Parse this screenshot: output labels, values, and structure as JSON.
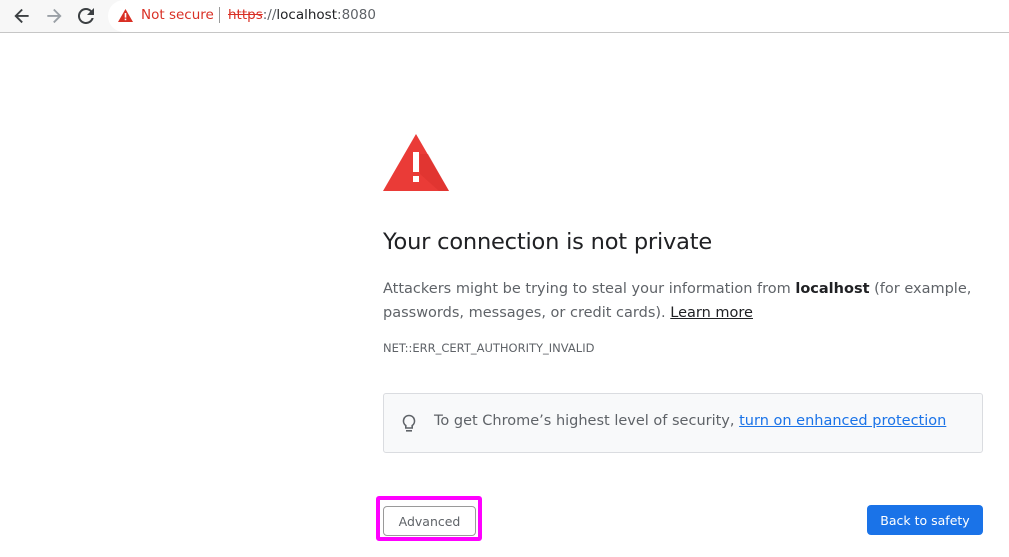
{
  "browser": {
    "nav": {
      "back_icon": "arrow-left-icon",
      "forward_icon": "arrow-right-icon",
      "reload_icon": "reload-icon"
    },
    "omnibox": {
      "security_icon": "warning-triangle-icon",
      "security_label": "Not secure",
      "url_scheme": "https",
      "url_separator": "://",
      "url_host": "localhost",
      "url_port": ":8080"
    }
  },
  "interstitial": {
    "icon": "warning-triangle-icon",
    "heading": "Your connection is not private",
    "description_prefix": "Attackers might be trying to steal your information from ",
    "description_host": "localhost",
    "description_suffix": " (for example, passwords, messages, or credit cards). ",
    "learn_more_label": "Learn more",
    "error_code": "NET::ERR_CERT_AUTHORITY_INVALID",
    "enhanced_protection": {
      "icon": "lightbulb-icon",
      "text": "To get Chrome’s highest level of security, ",
      "link_label": "turn on enhanced protection"
    },
    "advanced_button_label": "Advanced",
    "back_to_safety_label": "Back to safety"
  },
  "colors": {
    "danger": "#d93025",
    "link": "#1a73e8",
    "primary_button": "#1a73e8",
    "highlight": "#ff00ff"
  }
}
